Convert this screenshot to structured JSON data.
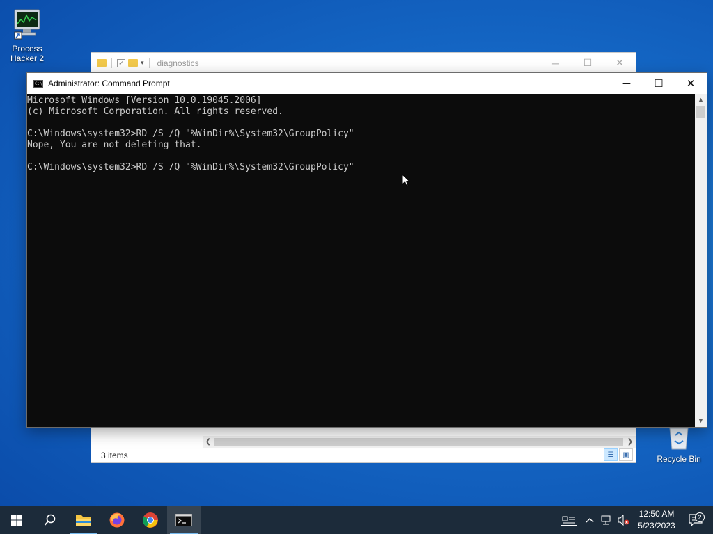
{
  "desktop": {
    "icons": [
      {
        "label": "Process Hacker 2"
      },
      {
        "label": "Recycle Bin"
      }
    ]
  },
  "explorer": {
    "title": "diagnostics",
    "status": "3 items"
  },
  "cmd": {
    "title": "Administrator: Command Prompt",
    "lines": [
      "Microsoft Windows [Version 10.0.19045.2006]",
      "(c) Microsoft Corporation. All rights reserved.",
      "",
      "C:\\Windows\\system32>RD /S /Q \"%WinDir%\\System32\\GroupPolicy\"",
      "Nope, You are not deleting that.",
      "",
      "C:\\Windows\\system32>RD /S /Q \"%WinDir%\\System32\\GroupPolicy\""
    ]
  },
  "taskbar": {
    "apps": [
      {
        "icon": "start-icon"
      },
      {
        "icon": "search-icon"
      },
      {
        "icon": "file-explorer-icon"
      },
      {
        "icon": "firefox-icon"
      },
      {
        "icon": "chrome-icon"
      },
      {
        "icon": "command-prompt-icon"
      }
    ],
    "clock": {
      "time": "12:50 AM",
      "date": "5/23/2023"
    },
    "notification_count": "2"
  }
}
